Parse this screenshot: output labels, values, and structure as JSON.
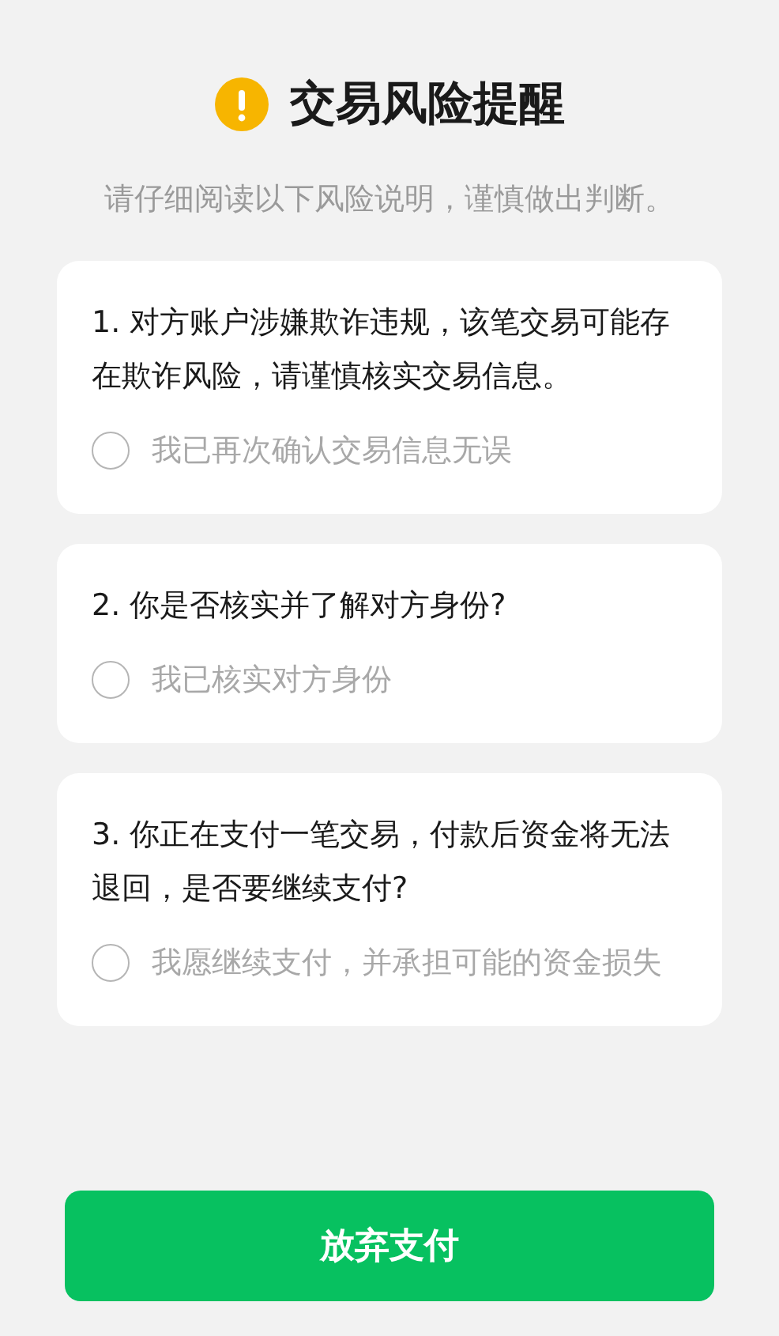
{
  "title": "交易风险提醒",
  "subtitle": "请仔细阅读以下风险说明，谨慎做出判断。",
  "items": [
    {
      "question": "1. 对方账户涉嫌欺诈违规，该笔交易可能存在欺诈风险，请谨慎核实交易信息。",
      "option": {
        "label": "我已再次确认交易信息无误",
        "checked": false
      }
    },
    {
      "question": "2. 你是否核实并了解对方身份?",
      "option": {
        "label": "我已核实对方身份",
        "checked": false
      }
    },
    {
      "question": "3. 你正在支付一笔交易，付款后资金将无法退回，是否要继续支付?",
      "option": {
        "label": "我愿继续支付，并承担可能的资金损失",
        "checked": false
      }
    }
  ],
  "button": {
    "label": "放弃支付"
  }
}
